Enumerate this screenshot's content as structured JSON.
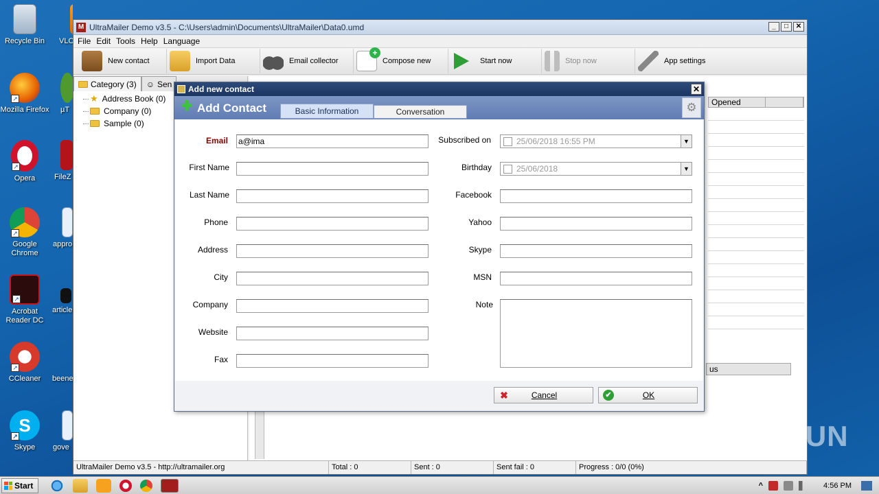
{
  "desktop": {
    "icons": [
      {
        "label": "Recycle Bin"
      },
      {
        "label": "Mozilla Firefox"
      },
      {
        "label": "Opera"
      },
      {
        "label": "Google Chrome"
      },
      {
        "label": "Acrobat Reader DC"
      },
      {
        "label": "CCleaner"
      },
      {
        "label": "Skype"
      },
      {
        "label": "VLC"
      },
      {
        "label": "µT"
      },
      {
        "label": "FileZ"
      },
      {
        "label": "appro"
      },
      {
        "label": "article"
      },
      {
        "label": "beene"
      },
      {
        "label": "gove"
      }
    ]
  },
  "app": {
    "title": "UltraMailer Demo v3.5 - C:\\Users\\admin\\Documents\\UltraMailer\\Data0.umd",
    "logo_letter": "M",
    "window_buttons": {
      "minimize": "_",
      "maximize": "□",
      "close": "✕"
    },
    "menu": [
      "File",
      "Edit",
      "Tools",
      "Help",
      "Language"
    ],
    "toolbar": [
      {
        "label": "New contact",
        "icon": "new-contact-icon",
        "color": "#8a5a2b"
      },
      {
        "label": "Import Data",
        "icon": "import-data-icon",
        "color": "#e8b33a"
      },
      {
        "label": "Email collector",
        "icon": "binoculars-icon",
        "color": "#444444"
      },
      {
        "label": "Compose new",
        "icon": "compose-icon",
        "color": "#2fb34a"
      },
      {
        "label": "Start now",
        "icon": "play-icon",
        "color": "#2e9e36"
      },
      {
        "label": "Stop now",
        "icon": "pause-icon",
        "color": "#b0b0b0"
      },
      {
        "label": "App settings",
        "icon": "wrench-icon",
        "color": "#777777"
      }
    ],
    "left_tabs": [
      {
        "label": "Category (3)"
      },
      {
        "label": "Sen"
      }
    ],
    "tree": [
      {
        "label": "Address Book (0)",
        "icon": "star"
      },
      {
        "label": "Company (0)",
        "icon": "folder"
      },
      {
        "label": "Sample (0)",
        "icon": "folder"
      }
    ],
    "grid": {
      "header": "Opened",
      "status_header": "us"
    },
    "statusbar": {
      "app_link": "UltraMailer Demo v3.5 - http://ultramailer.org",
      "total": "Total : 0",
      "sent": "Sent : 0",
      "sent_fail": "Sent fail : 0",
      "progress": "Progress : 0/0 (0%)"
    }
  },
  "dialog": {
    "title": "Add new contact",
    "heading": "Add Contact",
    "tabs": [
      {
        "label": "Basic Information",
        "active": true
      },
      {
        "label": "Conversation",
        "active": false
      }
    ],
    "left_fields": [
      {
        "label": "Email",
        "value": "a@ima",
        "required": true
      },
      {
        "label": "First Name",
        "value": ""
      },
      {
        "label": "Last Name",
        "value": ""
      },
      {
        "label": "Phone",
        "value": ""
      },
      {
        "label": "Address",
        "value": ""
      },
      {
        "label": "City",
        "value": ""
      },
      {
        "label": "Company",
        "value": ""
      },
      {
        "label": "Website",
        "value": ""
      },
      {
        "label": "Fax",
        "value": ""
      }
    ],
    "right_fields": {
      "subscribed_on": {
        "label": "Subscribed on",
        "value": "25/06/2018 16:55 PM"
      },
      "birthday": {
        "label": "Birthday",
        "value": "25/06/2018"
      },
      "facebook": {
        "label": "Facebook",
        "value": ""
      },
      "yahoo": {
        "label": "Yahoo",
        "value": ""
      },
      "skype": {
        "label": "Skype",
        "value": ""
      },
      "msn": {
        "label": "MSN",
        "value": ""
      },
      "note": {
        "label": "Note",
        "value": ""
      }
    },
    "buttons": {
      "cancel": "Cancel",
      "ok": "OK"
    },
    "colors": {
      "required_label": "#8b0000",
      "header": "#6a86bb"
    }
  },
  "taskbar": {
    "start_label": "Start",
    "clock": "4:56 PM",
    "tray_expand": "^"
  },
  "watermark": "ANY RUN"
}
